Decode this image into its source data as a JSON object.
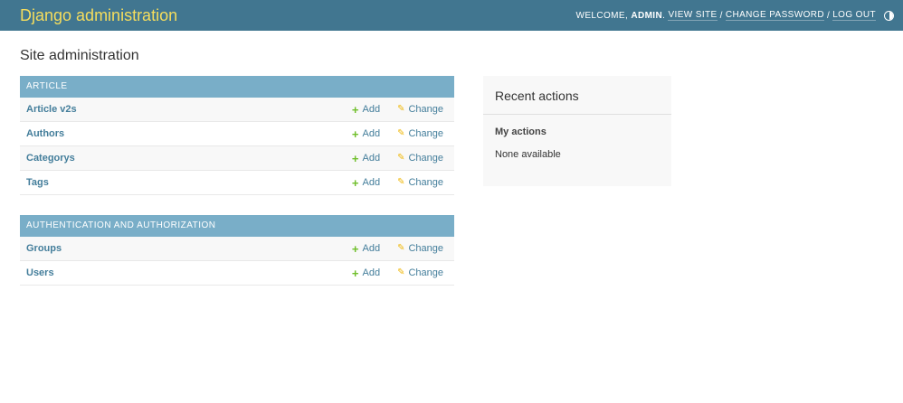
{
  "header": {
    "branding": "Django administration",
    "welcome": "Welcome,",
    "username": "admin",
    "view_site": "View site",
    "change_password": "Change password",
    "log_out": "Log out",
    "sep1": "/",
    "sep2": "/",
    "theme_icon": "half-circle-icon"
  },
  "page": {
    "title": "Site administration"
  },
  "modules": [
    {
      "caption": "Article",
      "models": [
        {
          "name": "Article v2s",
          "add": "Add",
          "change": "Change"
        },
        {
          "name": "Authors",
          "add": "Add",
          "change": "Change"
        },
        {
          "name": "Categorys",
          "add": "Add",
          "change": "Change"
        },
        {
          "name": "Tags",
          "add": "Add",
          "change": "Change"
        }
      ]
    },
    {
      "caption": "Authentication and Authorization",
      "models": [
        {
          "name": "Groups",
          "add": "Add",
          "change": "Change"
        },
        {
          "name": "Users",
          "add": "Add",
          "change": "Change"
        }
      ]
    }
  ],
  "recent_actions": {
    "title": "Recent actions",
    "subtitle": "My actions",
    "empty": "None available"
  },
  "icons": {
    "add": "+",
    "change": "✎"
  },
  "colors": {
    "header_bg": "#417690",
    "branding": "#f5dd5d",
    "caption_bg": "#79aec8",
    "link": "#447e9b",
    "add_icon": "#70bf2b",
    "change_icon": "#efb80b"
  }
}
